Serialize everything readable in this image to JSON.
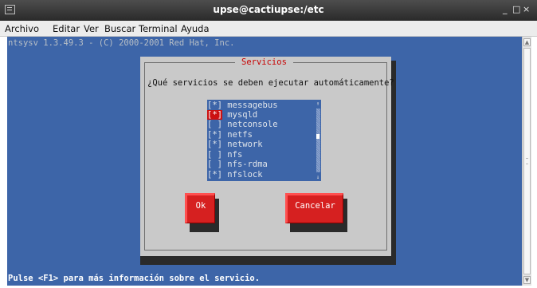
{
  "window": {
    "title": "upse@cactiupse:/etc",
    "minimize_glyph": "_",
    "maximize_glyph": "□",
    "close_glyph": "×"
  },
  "menu": [
    {
      "label": "Archivo"
    },
    {
      "label": "Editar"
    },
    {
      "label": "Ver"
    },
    {
      "label": "Buscar"
    },
    {
      "label": "Terminal"
    },
    {
      "label": "Ayuda"
    }
  ],
  "terminal": {
    "header_line": "ntsysv 1.3.49.3 - (C) 2000-2001 Red Hat, Inc.",
    "status_line": "Pulse <F1> para más información sobre el servicio."
  },
  "dialog": {
    "title": "Servicios",
    "question": "¿Qué servicios se deben ejecutar automáticamente?",
    "services": [
      {
        "mark": "[*]",
        "name": "messagebus",
        "checked": true
      },
      {
        "mark": "[*]",
        "name": "mysqld",
        "checked": true,
        "focused": true
      },
      {
        "mark": "[ ]",
        "name": "netconsole",
        "checked": false
      },
      {
        "mark": "[*]",
        "name": "netfs",
        "checked": true
      },
      {
        "mark": "[*]",
        "name": "network",
        "checked": true
      },
      {
        "mark": "[ ]",
        "name": "nfs",
        "checked": false
      },
      {
        "mark": "[ ]",
        "name": "nfs-rdma",
        "checked": false
      },
      {
        "mark": "[*]",
        "name": "nfslock",
        "checked": true
      }
    ],
    "list_scroll": {
      "up_glyph": "↑",
      "down_glyph": "↓"
    },
    "ok_label": "Ok",
    "cancel_label": "Cancelar"
  },
  "colors": {
    "terminal_bg": "#3d65a8",
    "dialog_bg": "#c9c9c9",
    "accent_red": "#d62020",
    "title_red": "#c80000"
  },
  "icons": {
    "app": "terminal-icon",
    "scroll_up": "arrow-up-icon",
    "scroll_down": "arrow-down-icon"
  }
}
